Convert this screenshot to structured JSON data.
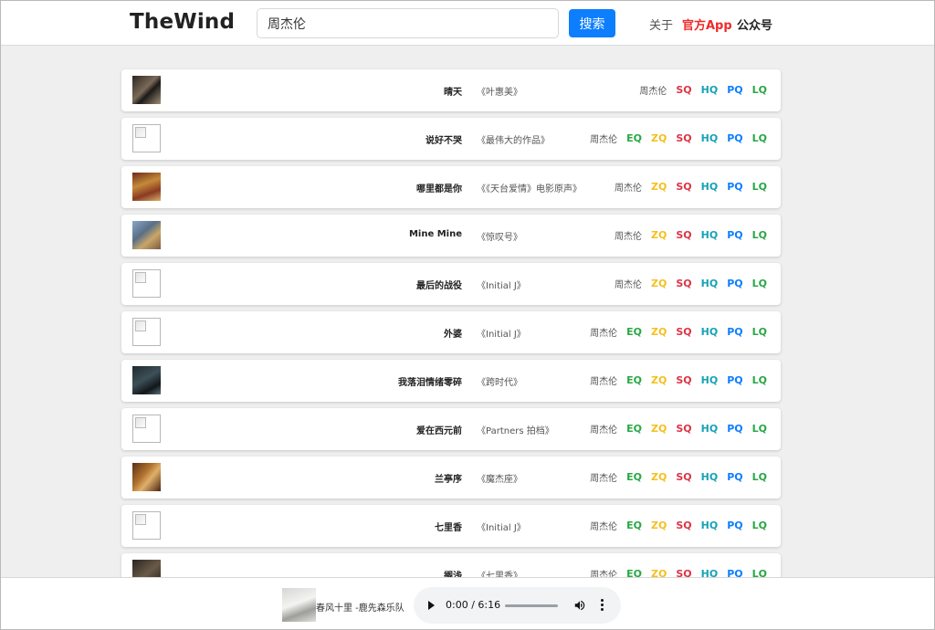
{
  "header": {
    "logo": "TheWind",
    "search_value": "周杰伦",
    "search_button": "搜索",
    "nav_about": "关于",
    "nav_app": "官方App",
    "nav_wechat": "公众号"
  },
  "colors": {
    "accent_blue": "#0d7efe",
    "app_red": "#ee2a2a",
    "EQ": "#27a844",
    "ZQ": "#f5bf1f",
    "SQ": "#dc3545",
    "HQ": "#17a2b8",
    "PQ": "#0d7efe",
    "LQ": "#28a745"
  },
  "songs": [
    {
      "title": "晴天",
      "album": "《叶惠美》",
      "artist": "周杰伦",
      "cover": "image",
      "qualities": [
        "SQ",
        "HQ",
        "PQ",
        "LQ"
      ]
    },
    {
      "title": "说好不哭",
      "album": "《最伟大的作品》",
      "artist": "周杰伦",
      "cover": "broken-image-icon",
      "qualities": [
        "EQ",
        "ZQ",
        "SQ",
        "HQ",
        "PQ",
        "LQ"
      ]
    },
    {
      "title": "哪里都是你",
      "album": "《《天台爱情》电影原声》",
      "artist": "周杰伦",
      "cover": "image",
      "qualities": [
        "ZQ",
        "SQ",
        "HQ",
        "PQ",
        "LQ"
      ]
    },
    {
      "title": "Mine Mine",
      "album": "《惊叹号》",
      "artist": "周杰伦",
      "cover": "image",
      "qualities": [
        "ZQ",
        "SQ",
        "HQ",
        "PQ",
        "LQ"
      ]
    },
    {
      "title": "最后的战役",
      "album": "《Initial J》",
      "artist": "周杰伦",
      "cover": "broken-image-icon",
      "qualities": [
        "ZQ",
        "SQ",
        "HQ",
        "PQ",
        "LQ"
      ]
    },
    {
      "title": "外婆",
      "album": "《Initial J》",
      "artist": "周杰伦",
      "cover": "broken-image-icon",
      "qualities": [
        "EQ",
        "ZQ",
        "SQ",
        "HQ",
        "PQ",
        "LQ"
      ]
    },
    {
      "title": "我落泪情绪零碎",
      "album": "《跨时代》",
      "artist": "周杰伦",
      "cover": "image",
      "qualities": [
        "EQ",
        "ZQ",
        "SQ",
        "HQ",
        "PQ",
        "LQ"
      ]
    },
    {
      "title": "爱在西元前",
      "album": "《Partners 拍档》",
      "artist": "周杰伦",
      "cover": "broken-image-icon",
      "qualities": [
        "EQ",
        "ZQ",
        "SQ",
        "HQ",
        "PQ",
        "LQ"
      ]
    },
    {
      "title": "兰亭序",
      "album": "《魔杰座》",
      "artist": "周杰伦",
      "cover": "image",
      "qualities": [
        "EQ",
        "ZQ",
        "SQ",
        "HQ",
        "PQ",
        "LQ"
      ]
    },
    {
      "title": "七里香",
      "album": "《Initial J》",
      "artist": "周杰伦",
      "cover": "broken-image-icon",
      "qualities": [
        "EQ",
        "ZQ",
        "SQ",
        "HQ",
        "PQ",
        "LQ"
      ]
    },
    {
      "title": "搁浅",
      "album": "《七里香》",
      "artist": "周杰伦",
      "cover": "image",
      "qualities": [
        "EQ",
        "ZQ",
        "SQ",
        "HQ",
        "PQ",
        "LQ"
      ]
    }
  ],
  "player": {
    "track_label": "春风十里 -鹿先森乐队",
    "time": "0:00 / 6:16",
    "progress": 0,
    "play_icon": "play-icon",
    "volume_icon": "volume-icon",
    "menu_icon": "more-vertical-icon"
  }
}
